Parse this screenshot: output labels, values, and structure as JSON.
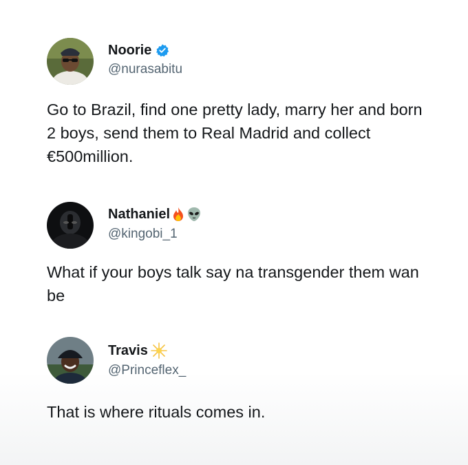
{
  "tweets": [
    {
      "name": "Noorie",
      "handle": "@nurasabitu",
      "badge_icon": "verified-badge-icon",
      "body": "Go to Brazil, find one pretty lady, marry her and born 2 boys, send them to Real Madrid and collect €500million."
    },
    {
      "name": "Nathaniel",
      "handle": "@kingobi_1",
      "badge_icons": [
        "fire-emoji-icon",
        "alien-emoji-icon"
      ],
      "body": "What if your boys talk say na transgender them wan be"
    },
    {
      "name": "Travis",
      "handle": "@Princeflex_",
      "badge_icon": "sparkle-sun-emoji-icon",
      "body": "That is where rituals comes in."
    }
  ],
  "colors": {
    "text": "#14171a",
    "handle": "#536471",
    "verified_blue": "#1d9bf0"
  }
}
